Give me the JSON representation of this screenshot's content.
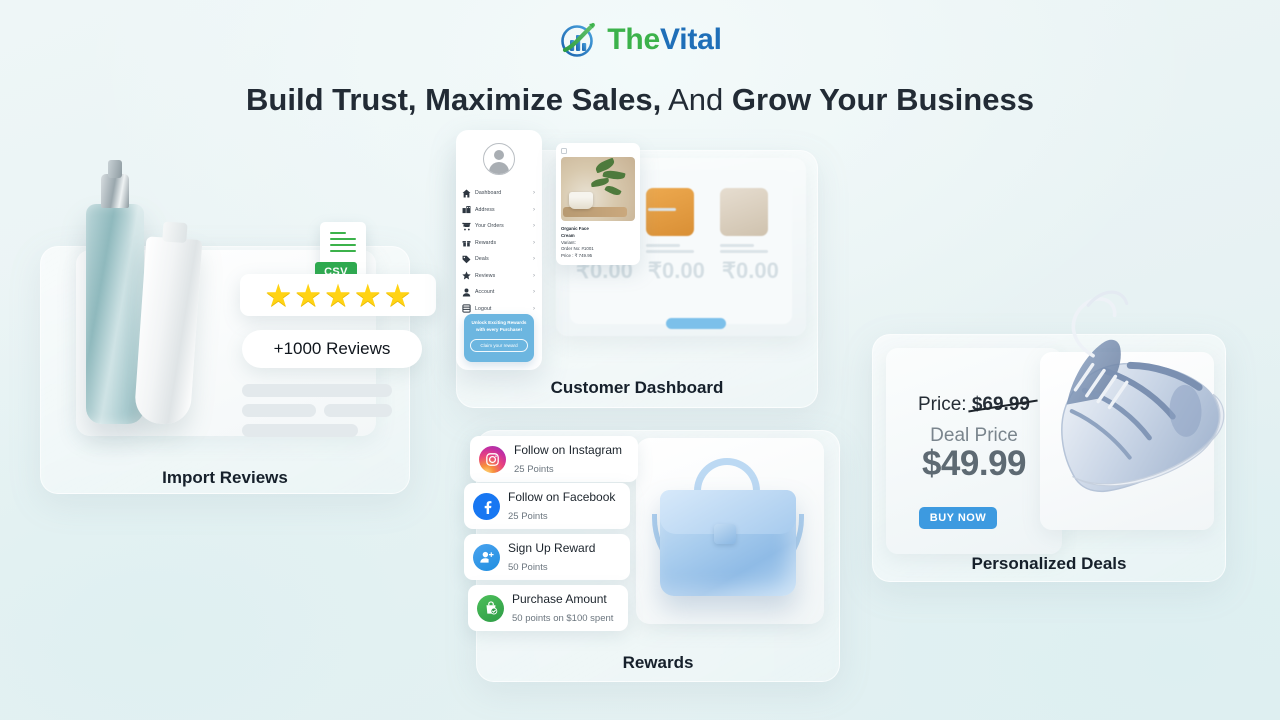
{
  "brand": {
    "mark_icon": "thevital-logo-icon",
    "name_part1": "The",
    "name_part2": "Vital"
  },
  "headline": {
    "bold1": "Build Trust, Maximize Sales,",
    "light": " And ",
    "bold2": "Grow Your Business"
  },
  "panels": {
    "import_reviews": {
      "caption": "Import Reviews",
      "stars": 5,
      "star_glyph": "★",
      "reviews_pill": "+1000 Reviews",
      "csv_badge": "CSV",
      "csv_icon": "csv-file-icon",
      "bottle_icon": "serum-bottle-product",
      "tube_icon": "cream-tube-product"
    },
    "customer_dashboard": {
      "caption": "Customer Dashboard",
      "avatar_icon": "user-avatar-icon",
      "menu": [
        {
          "label": "Dashboard",
          "icon": "home-icon",
          "chevron": "›"
        },
        {
          "label": "Address",
          "icon": "building-icon",
          "chevron": "›"
        },
        {
          "label": "Your Orders",
          "icon": "cart-icon",
          "chevron": "›"
        },
        {
          "label": "Rewards",
          "icon": "gift-icon",
          "chevron": "›"
        },
        {
          "label": "Deals",
          "icon": "tag-icon",
          "chevron": "›"
        },
        {
          "label": "Reviews",
          "icon": "star-icon",
          "chevron": "›"
        },
        {
          "label": "Account",
          "icon": "person-icon",
          "chevron": "›"
        },
        {
          "label": "Logout",
          "icon": "logout-icon",
          "chevron": "›"
        }
      ],
      "promo": {
        "line1": "Unlock Exciting Rewards",
        "line2": "with every Purchase!",
        "button": "Claim your reward"
      },
      "order_card": {
        "title_line1": "Organic Face",
        "title_line2": "Cream",
        "variant": "Variant:",
        "order_no": "Order No: #1001",
        "price": "Price : ₹ 749.95",
        "image_icon": "organic-face-cream-photo"
      }
    },
    "rewards": {
      "caption": "Rewards",
      "items": [
        {
          "title": "Follow on Instagram",
          "sub": "25 Points",
          "icon": "instagram-icon"
        },
        {
          "title": "Follow on Facebook",
          "sub": "25 Points",
          "icon": "facebook-icon"
        },
        {
          "title": "Sign Up Reward",
          "sub": "50 Points",
          "icon": "add-user-icon"
        },
        {
          "title": "Purchase Amount",
          "sub": "50 points on $100 spent",
          "icon": "shopping-bag-check-icon"
        }
      ],
      "product_icon": "blue-handbag-photo"
    },
    "personalized_deals": {
      "caption": "Personalized Deals",
      "price_label": "Price:",
      "price_old": "$69.99",
      "deal_label": "Deal Price",
      "deal_price": "$49.99",
      "buy_button": "BUY NOW",
      "product_icon": "blue-sneaker-photo"
    }
  },
  "colors": {
    "brand_green": "#3cb24b",
    "brand_blue": "#1f6fb8",
    "star_yellow": "#FFD314",
    "csv_green": "#2eaa4f",
    "promo_blue": "#6cb6e0",
    "buy_blue": "#3d9ae0",
    "instagram_pink": "#e8437e",
    "facebook_blue": "#1877F2"
  }
}
